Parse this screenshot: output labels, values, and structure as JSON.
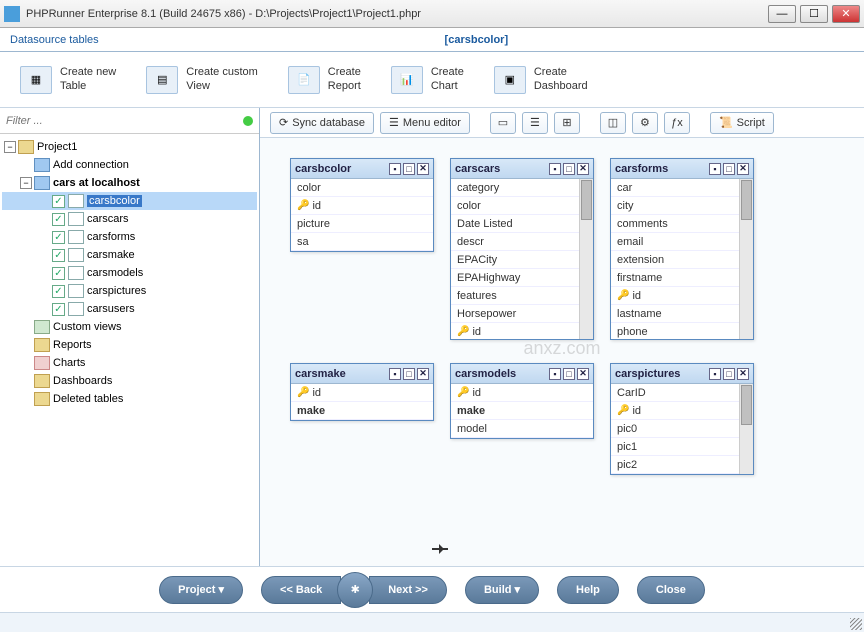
{
  "window": {
    "title": "PHPRunner Enterprise 8.1 (Build 24675 x86) - D:\\Projects\\Project1\\Project1.phpr"
  },
  "subheader": {
    "datasource_label": "Datasource tables",
    "current_table": "[carsbcolor]"
  },
  "toolbar": {
    "create_table": "Create new\nTable",
    "create_view": "Create custom\nView",
    "create_report": "Create\nReport",
    "create_chart": "Create\nChart",
    "create_dashboard": "Create\nDashboard"
  },
  "filter": {
    "placeholder": "Filter ..."
  },
  "tree": {
    "root": "Project1",
    "add_connection": "Add connection",
    "db": "cars at localhost",
    "tables": [
      "carsbcolor",
      "carscars",
      "carsforms",
      "carsmake",
      "carsmodels",
      "carspictures",
      "carsusers"
    ],
    "custom_views": "Custom views",
    "reports": "Reports",
    "charts": "Charts",
    "dashboards": "Dashboards",
    "deleted": "Deleted tables"
  },
  "canvas_toolbar": {
    "sync": "Sync database",
    "menu_editor": "Menu editor",
    "script": "Script"
  },
  "entities": {
    "carsbcolor": {
      "title": "carsbcolor",
      "fields": [
        "color",
        "id",
        "picture",
        "sa"
      ],
      "keys": [
        "id"
      ]
    },
    "carscars": {
      "title": "carscars",
      "fields": [
        "category",
        "color",
        "Date Listed",
        "descr",
        "EPACity",
        "EPAHighway",
        "features",
        "Horsepower",
        "id"
      ],
      "keys": [
        "id"
      ]
    },
    "carsforms": {
      "title": "carsforms",
      "fields": [
        "car",
        "city",
        "comments",
        "email",
        "extension",
        "firstname",
        "id",
        "lastname",
        "phone"
      ],
      "keys": [
        "id"
      ]
    },
    "carsmake": {
      "title": "carsmake",
      "fields": [
        "id",
        "make"
      ],
      "keys": [
        "id"
      ],
      "bold": [
        "make"
      ]
    },
    "carsmodels": {
      "title": "carsmodels",
      "fields": [
        "id",
        "make",
        "model"
      ],
      "keys": [
        "id"
      ],
      "bold": [
        "make"
      ]
    },
    "carspictures": {
      "title": "carspictures",
      "fields": [
        "CarID",
        "id",
        "pic0",
        "pic1",
        "pic2"
      ],
      "keys": [
        "id"
      ]
    }
  },
  "bottom": {
    "project": "Project",
    "back": "<< Back",
    "next": "Next >>",
    "build": "Build",
    "help": "Help",
    "close": "Close"
  },
  "watermark": "anxz.com"
}
